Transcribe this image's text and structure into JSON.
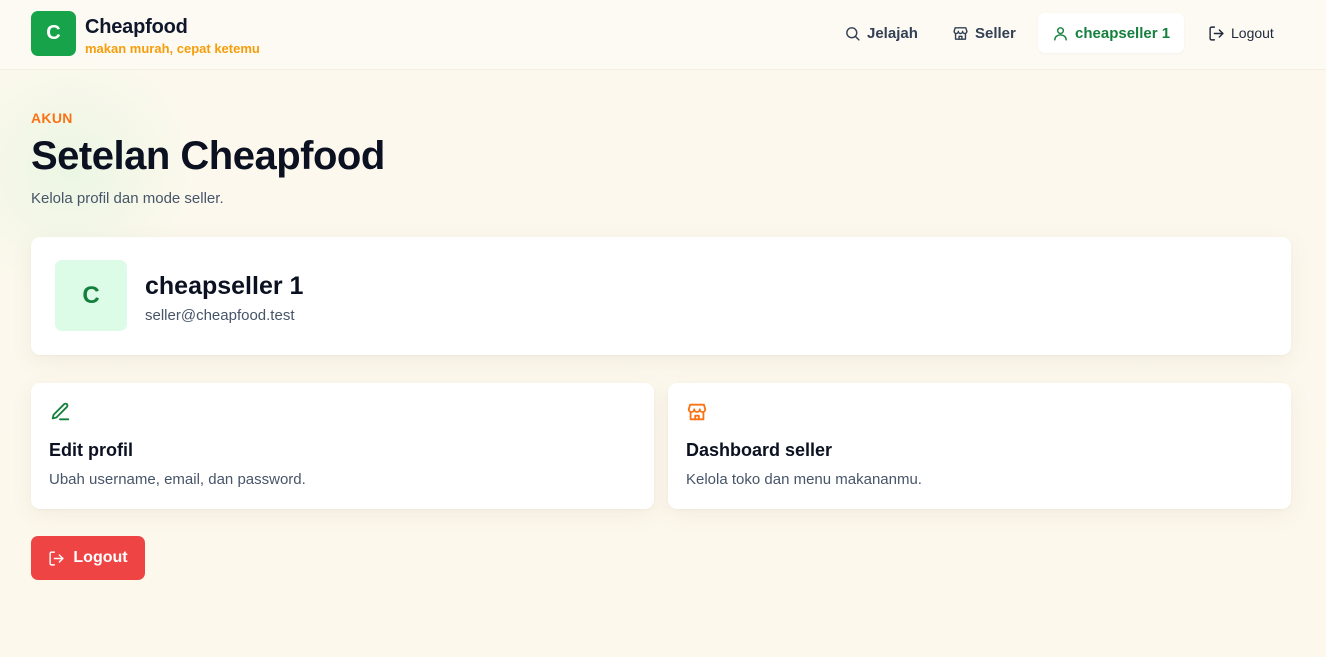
{
  "brand": {
    "logo_letter": "C",
    "name": "Cheapfood",
    "tagline": "makan murah, cepat ketemu",
    "color": "#16a34a"
  },
  "nav": {
    "explore": {
      "label": "Jelajah",
      "icon": "search-icon"
    },
    "seller": {
      "label": "Seller",
      "icon": "store-icon"
    },
    "user": {
      "label": "cheapseller 1",
      "icon": "user-icon",
      "active": true
    },
    "logout": {
      "label": "Logout",
      "icon": "logout-icon"
    }
  },
  "page": {
    "eyebrow": "AKUN",
    "title": "Setelan Cheapfood",
    "subtitle": "Kelola profil dan mode seller."
  },
  "profile": {
    "avatar_letter": "C",
    "name": "cheapseller 1",
    "email": "seller@cheapfood.test"
  },
  "actions": [
    {
      "title": "Edit profil",
      "description": "Ubah username, email, dan password.",
      "icon": "pencil-icon",
      "icon_color": "#15803d"
    },
    {
      "title": "Dashboard seller",
      "description": "Kelola toko dan menu makananmu.",
      "icon": "store-icon",
      "icon_color": "#f97316"
    }
  ],
  "logout_button": {
    "label": "Logout",
    "color": "#ef4444",
    "icon": "logout-icon"
  },
  "colors": {
    "accent_orange": "#f97316",
    "accent_green": "#15803d",
    "danger": "#ef4444"
  }
}
